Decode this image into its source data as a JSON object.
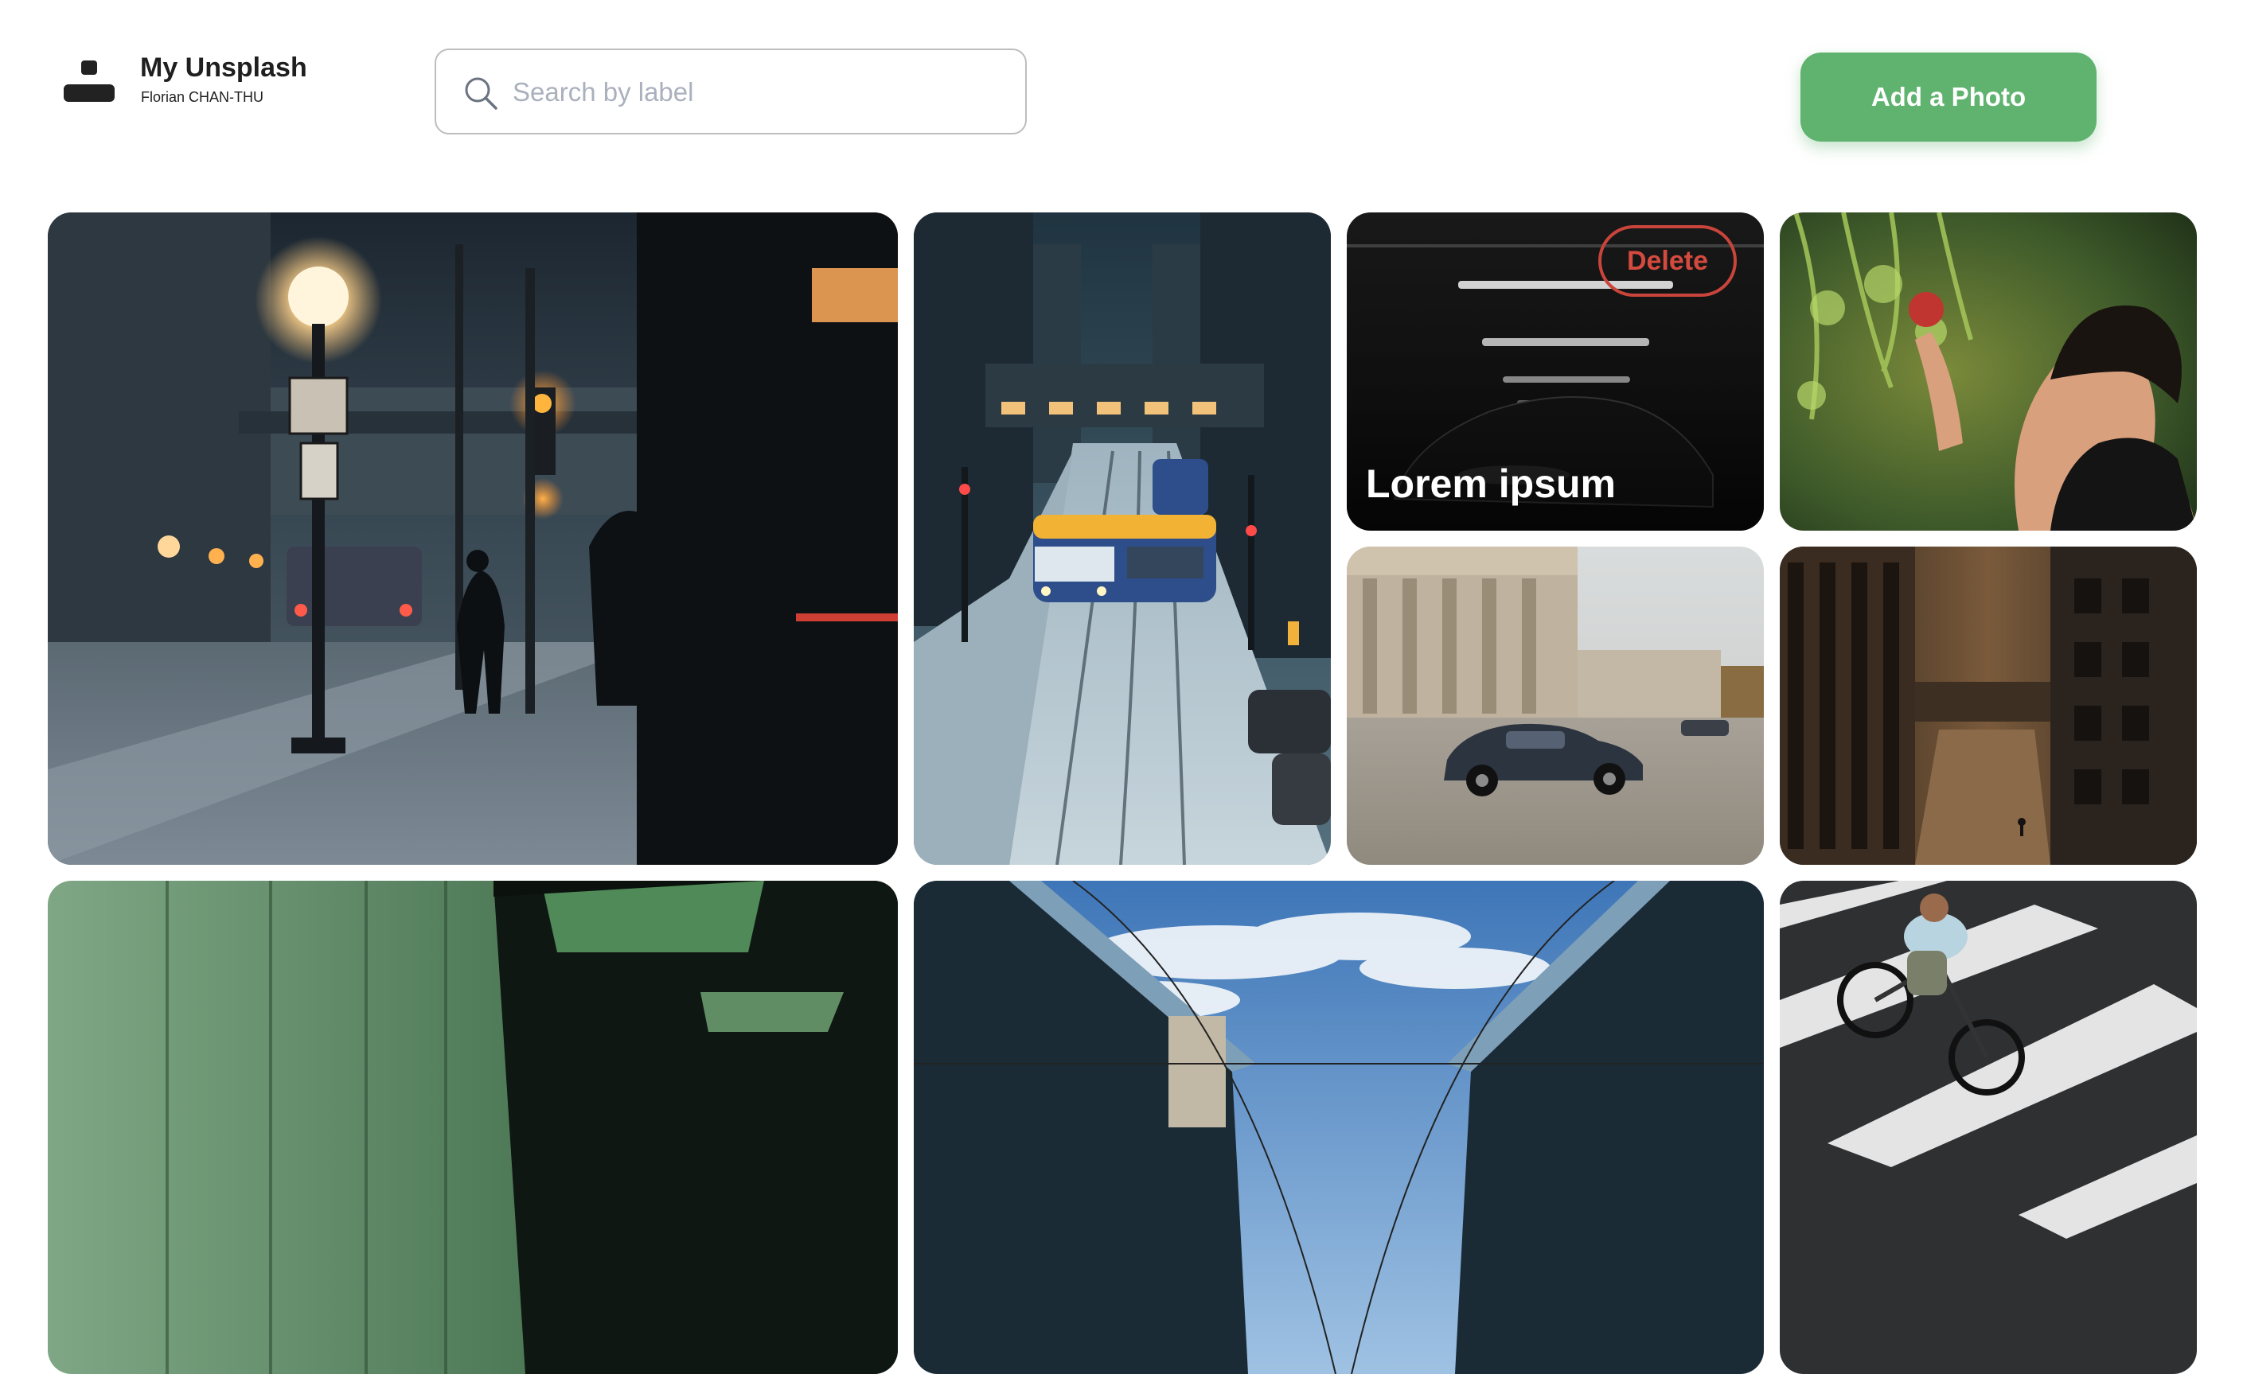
{
  "header": {
    "app_title": "My Unsplash",
    "user_name": "Florian CHAN-THU",
    "logo_icon": "unsplash-logo-icon"
  },
  "search": {
    "placeholder": "Search by label",
    "value": "",
    "icon": "search-icon"
  },
  "actions": {
    "add_photo_label": "Add a Photo"
  },
  "colors": {
    "accent_green": "#5fb36f",
    "delete_red": "#d54a3f",
    "text_dark": "#1f1f1f",
    "placeholder_gray": "#aab0bd"
  },
  "gallery": {
    "photos": [
      {
        "subject": "snowy-night-street-streetlamp-tram"
      },
      {
        "subject": "snowy-city-tram-skybridge"
      },
      {
        "subject": "dark-car-garage",
        "label": "Lorem ipsum",
        "delete_label": "Delete",
        "hovered": true
      },
      {
        "subject": "woman-apple-tree"
      },
      {
        "subject": "classic-porsche-cobblestone-courtyard"
      },
      {
        "subject": "city-buildings-courtyard-aerial"
      },
      {
        "subject": "green-glass-wall-architecture"
      },
      {
        "subject": "bridges-overhead-wires-sky"
      },
      {
        "subject": "cyclist-crosswalk-aerial"
      }
    ]
  }
}
